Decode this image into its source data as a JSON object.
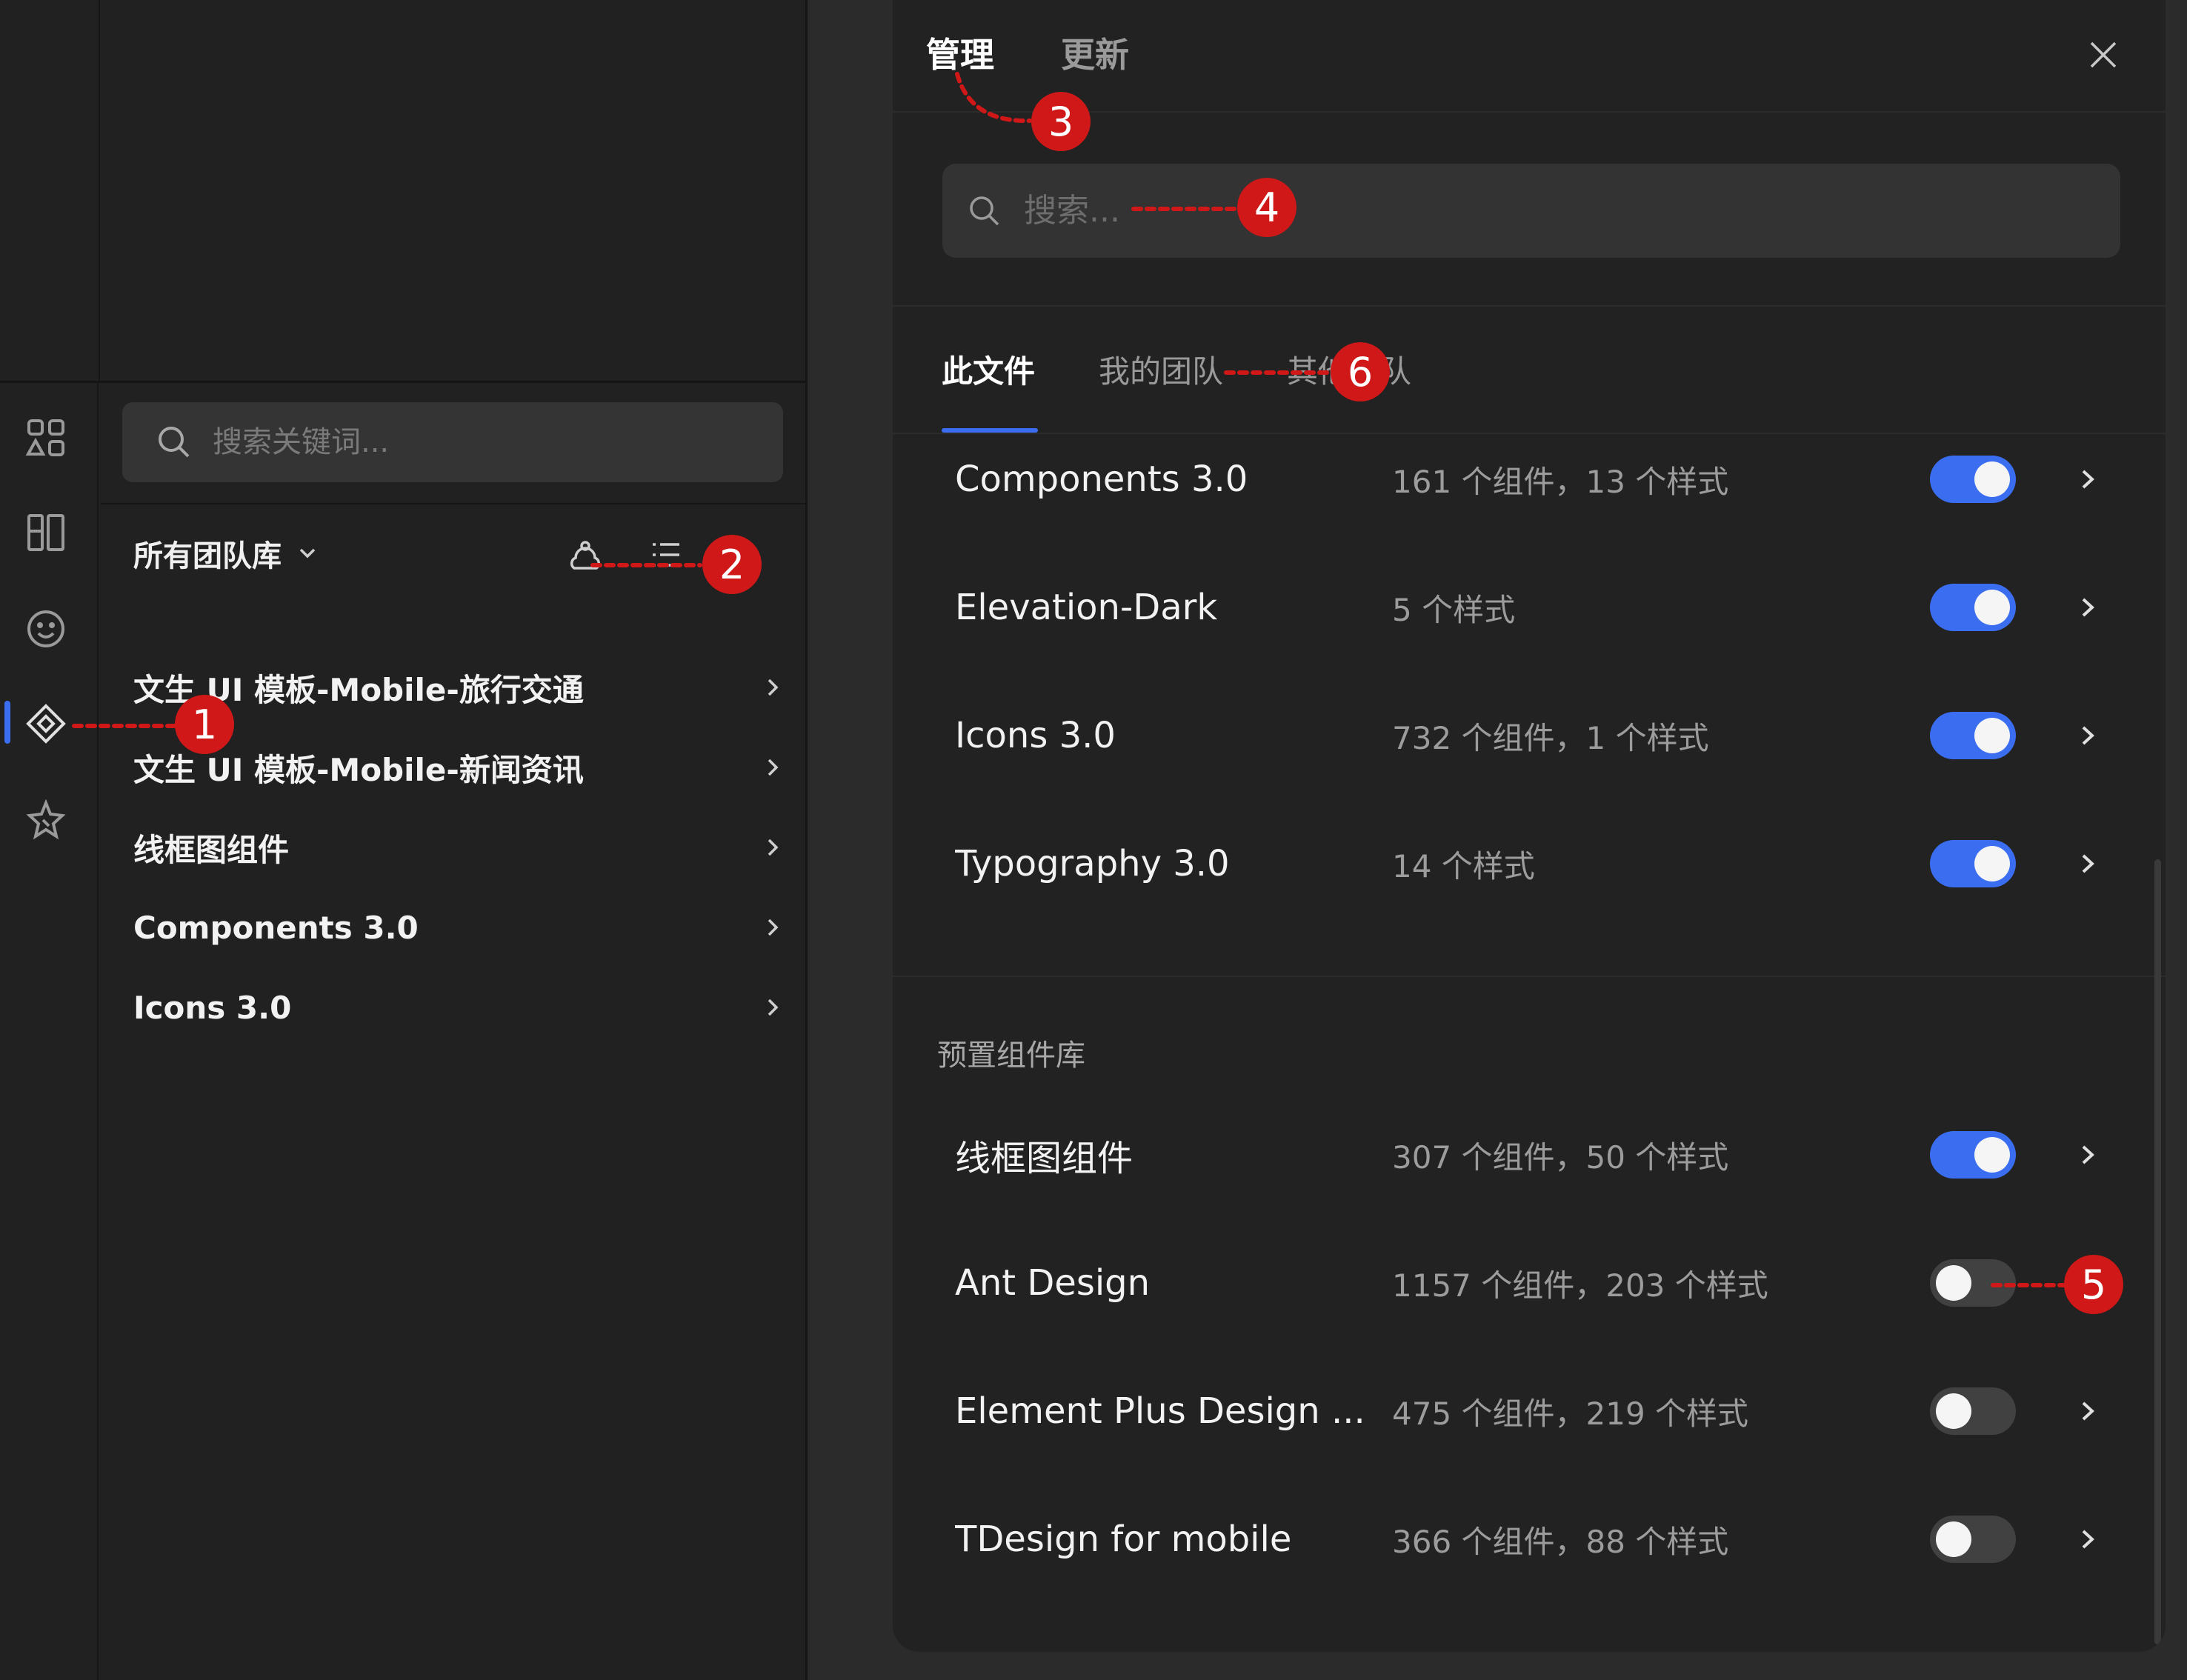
{
  "left_panel": {
    "search_placeholder": "搜索关键词...",
    "library_filter": "所有团队库",
    "libraries": [
      {
        "label": "文生 UI 模板-Mobile-旅行交通"
      },
      {
        "label": "文生 UI 模板-Mobile-新闻资讯"
      },
      {
        "label": "线框图组件"
      },
      {
        "label": "Components 3.0"
      },
      {
        "label": "Icons 3.0"
      }
    ],
    "rail_icons": [
      "layers-icon",
      "layout-icon",
      "emoji-icon",
      "component-icon",
      "plugin-icon"
    ]
  },
  "modal": {
    "tabs": [
      "管理",
      "更新"
    ],
    "active_tab": "管理",
    "search_placeholder": "搜索...",
    "scope_tabs": [
      "此文件",
      "我的团队",
      "其他团队"
    ],
    "active_scope": "此文件",
    "this_file_libraries": [
      {
        "name": "Components 3.0",
        "meta": "161 个组件，13 个样式",
        "enabled": true
      },
      {
        "name": "Elevation-Dark",
        "meta": "5 个样式",
        "enabled": true
      },
      {
        "name": "Icons 3.0",
        "meta": "732 个组件，1 个样式",
        "enabled": true
      },
      {
        "name": "Typography 3.0",
        "meta": "14 个样式",
        "enabled": true
      }
    ],
    "preset_section_title": "预置组件库",
    "preset_libraries": [
      {
        "name": "线框图组件",
        "meta": "307 个组件，50 个样式",
        "enabled": true
      },
      {
        "name": "Ant Design",
        "meta": "1157 个组件，203 个样式",
        "enabled": false
      },
      {
        "name": "Element Plus Design ...",
        "meta": "475 个组件，219 个样式",
        "enabled": false
      },
      {
        "name": "TDesign for mobile",
        "meta": "366 个组件，88 个样式",
        "enabled": false
      }
    ]
  },
  "annotations": [
    "1",
    "2",
    "3",
    "4",
    "5",
    "6"
  ],
  "colors": {
    "accent": "#3a6df0",
    "annotation": "#d01818",
    "panel_bg": "#212121",
    "modal_bg": "#222222"
  }
}
